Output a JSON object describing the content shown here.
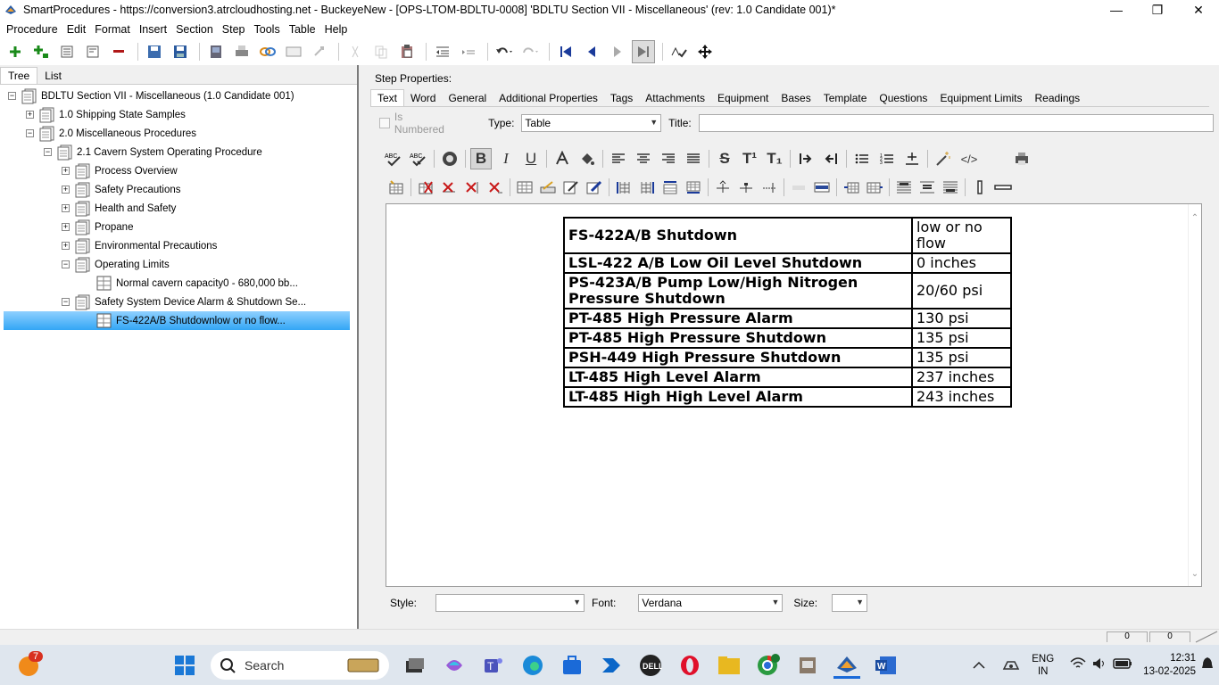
{
  "window": {
    "title": "SmartProcedures - https://conversion3.atrcloudhosting.net - BuckeyeNew - [OPS-LTOM-BDLTU-0008] 'BDLTU Section VII - Miscellaneous' (rev: 1.0 Candidate 001)*"
  },
  "menu": [
    "Procedure",
    "Edit",
    "Format",
    "Insert",
    "Section",
    "Step",
    "Tools",
    "Table",
    "Help"
  ],
  "left_tabs": {
    "tree": "Tree",
    "list": "List"
  },
  "tree": [
    {
      "label": "BDLTU Section VII - Miscellaneous (1.0 Candidate 001)",
      "exp": "−"
    },
    {
      "label": "1.0 Shipping State Samples",
      "exp": "+"
    },
    {
      "label": "2.0 Miscellaneous Procedures",
      "exp": "−"
    },
    {
      "label": "2.1 Cavern System Operating Procedure",
      "exp": "−"
    },
    {
      "label": "Process Overview",
      "exp": "+"
    },
    {
      "label": "Safety Precautions",
      "exp": "+"
    },
    {
      "label": "Health and Safety",
      "exp": "+"
    },
    {
      "label": "Propane",
      "exp": "+"
    },
    {
      "label": "Environmental Precautions",
      "exp": "+"
    },
    {
      "label": "Operating Limits",
      "exp": "−"
    },
    {
      "label": "Normal cavern capacity0 - 680,000 bb...",
      "exp": ""
    },
    {
      "label": "Safety System Device Alarm & Shutdown Se...",
      "exp": "−"
    },
    {
      "label": "FS-422A/B Shutdownlow or no flow...",
      "exp": ""
    }
  ],
  "step_properties_label": "Step Properties:",
  "tabs": [
    "Text",
    "Word",
    "General",
    "Additional Properties",
    "Tags",
    "Attachments",
    "Equipment",
    "Bases",
    "Template",
    "Questions",
    "Equipment Limits",
    "Readings"
  ],
  "type_row": {
    "is_numbered": "Is Numbered",
    "type_label": "Type:",
    "type_value": "Table",
    "title_label": "Title:",
    "title_value": ""
  },
  "format_buttons": {
    "bold": "B",
    "italic": "I",
    "underline": "U",
    "strike": "S",
    "superscript": "T¹",
    "subscript": "T₁",
    "source": "</>"
  },
  "table_rows": [
    {
      "item": "FS-422A/B Shutdown",
      "value": "low or no flow"
    },
    {
      "item": "LSL-422 A/B Low Oil Level Shutdown",
      "value": "0 inches"
    },
    {
      "item": "PS-423A/B Pump Low/High Nitrogen Pressure Shutdown",
      "value": "20/60 psi"
    },
    {
      "item": "PT-485 High Pressure Alarm",
      "value": "130 psi"
    },
    {
      "item": "PT-485 High Pressure Shutdown",
      "value": "135 psi"
    },
    {
      "item": "PSH-449 High Pressure Shutdown",
      "value": "135 psi"
    },
    {
      "item": "LT-485 High Level Alarm",
      "value": "237 inches"
    },
    {
      "item": "LT-485 High High Level Alarm",
      "value": "243 inches"
    }
  ],
  "style_row": {
    "style_label": "Style:",
    "style_value": "",
    "font_label": "Font:",
    "font_value": "Verdana",
    "size_label": "Size:",
    "size_value": ""
  },
  "status": {
    "field1": "0",
    "field2": "0"
  },
  "taskbar": {
    "search": "Search",
    "badge": "7",
    "lang1": "ENG",
    "lang2": "IN",
    "time": "12:31",
    "date": "13-02-2025"
  },
  "colors": {
    "selection": "#33a6f5",
    "taskbar": "#dfe6ee"
  }
}
